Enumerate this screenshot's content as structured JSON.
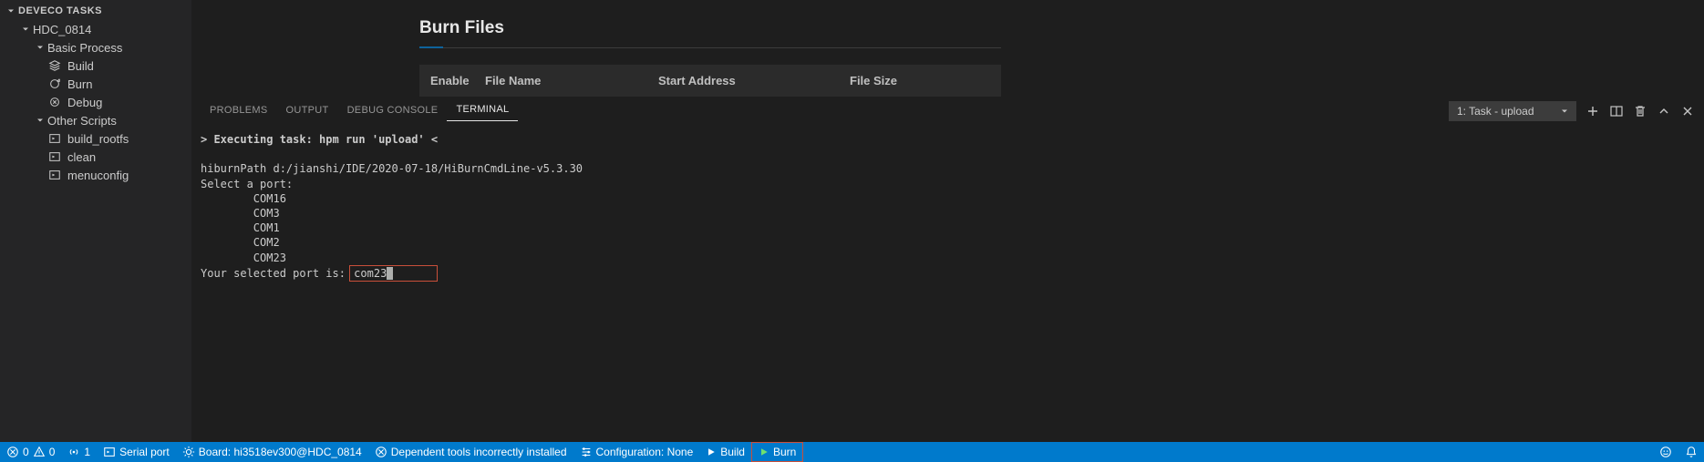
{
  "sidebar": {
    "section_title": "DEVECO TASKS",
    "root": "HDC_0814",
    "basic_process": "Basic Process",
    "build": "Build",
    "burn": "Burn",
    "debug": "Debug",
    "other_scripts": "Other Scripts",
    "build_rootfs": "build_rootfs",
    "clean": "clean",
    "menuconfig": "menuconfig"
  },
  "editor": {
    "title": "Burn Files",
    "th_enable": "Enable",
    "th_file": "File Name",
    "th_start": "Start Address",
    "th_size": "File Size"
  },
  "panel": {
    "problems": "PROBLEMS",
    "output": "OUTPUT",
    "debug_console": "DEBUG CONSOLE",
    "terminal": "TERMINAL",
    "task_select": "1: Task - upload"
  },
  "terminal": {
    "line1": "> Executing task: hpm run 'upload' <",
    "line2": "hiburnPath d:/jianshi/IDE/2020-07-18/HiBurnCmdLine-v5.3.30",
    "line3": "Select a port:",
    "port1": "COM16",
    "port2": "COM3",
    "port3": "COM1",
    "port4": "COM2",
    "port5": "COM23",
    "selected_prefix": "Your selected port is: ",
    "selected_value": "com23"
  },
  "statusbar": {
    "errors": "0",
    "warnings": "0",
    "ports": "1",
    "serial_port": "Serial port",
    "board": "Board: hi3518ev300@HDC_0814",
    "dep_tools": "Dependent tools incorrectly installed",
    "config": "Configuration: None",
    "build": "Build",
    "burn": "Burn"
  }
}
